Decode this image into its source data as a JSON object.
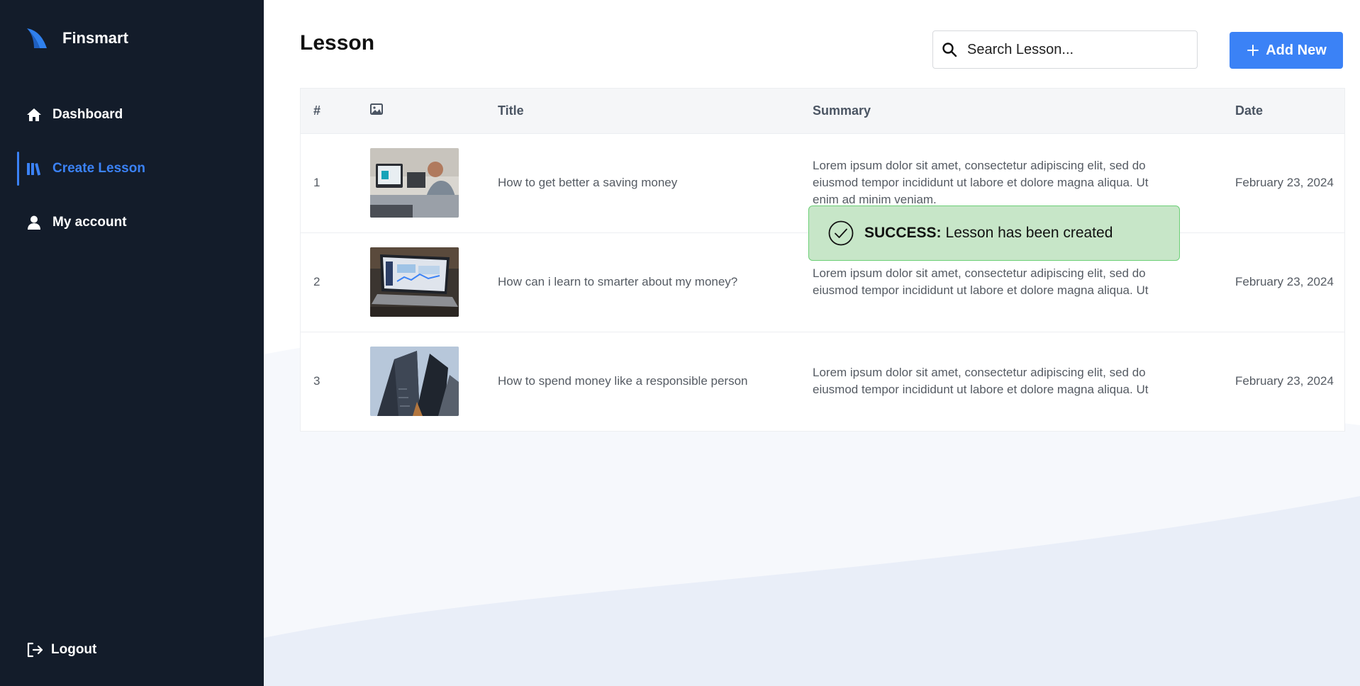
{
  "app": {
    "name": "Finsmart"
  },
  "sidebar": {
    "items": [
      {
        "label": "Dashboard",
        "icon": "home-icon"
      },
      {
        "label": "Create Lesson",
        "icon": "books-icon",
        "active": true
      },
      {
        "label": "My account",
        "icon": "user-icon"
      }
    ],
    "logout_label": "Logout"
  },
  "page": {
    "title": "Lesson"
  },
  "search": {
    "placeholder": "Search Lesson..."
  },
  "toolbar": {
    "add_label": "Add New"
  },
  "table": {
    "headers": {
      "num": "#",
      "image_icon": "image-icon",
      "title": "Title",
      "summary": "Summary",
      "date": "Date"
    },
    "rows": [
      {
        "num": "1",
        "image": "office-workspace-photo",
        "title": "How to get better a saving money",
        "summary": "Lorem ipsum dolor sit amet, consectetur adipiscing elit, sed do eiusmod tempor incididunt ut labore et dolore magna aliqua. Ut enim ad minim veniam.",
        "date": "February 23, 2024"
      },
      {
        "num": "2",
        "image": "laptop-dashboard-photo",
        "title": "How can i learn to smarter about my money?",
        "summary": "Lorem ipsum dolor sit amet, consectetur adipiscing elit, sed do eiusmod tempor incididunt ut labore et dolore magna aliqua. Ut",
        "date": "February 23, 2024"
      },
      {
        "num": "3",
        "image": "skyscrapers-photo",
        "title": "How to spend money like a responsible person",
        "summary": "Lorem ipsum dolor sit amet, consectetur adipiscing elit, sed do eiusmod tempor incididunt ut labore et dolore magna aliqua. Ut",
        "date": "February 23, 2024"
      }
    ]
  },
  "toast": {
    "label": "SUCCESS:",
    "message": "Lesson has been created"
  },
  "colors": {
    "sidebar_bg": "#131c2a",
    "accent": "#3b82f6",
    "toast_bg": "#c7e6c8",
    "toast_border": "#6ccf76"
  }
}
